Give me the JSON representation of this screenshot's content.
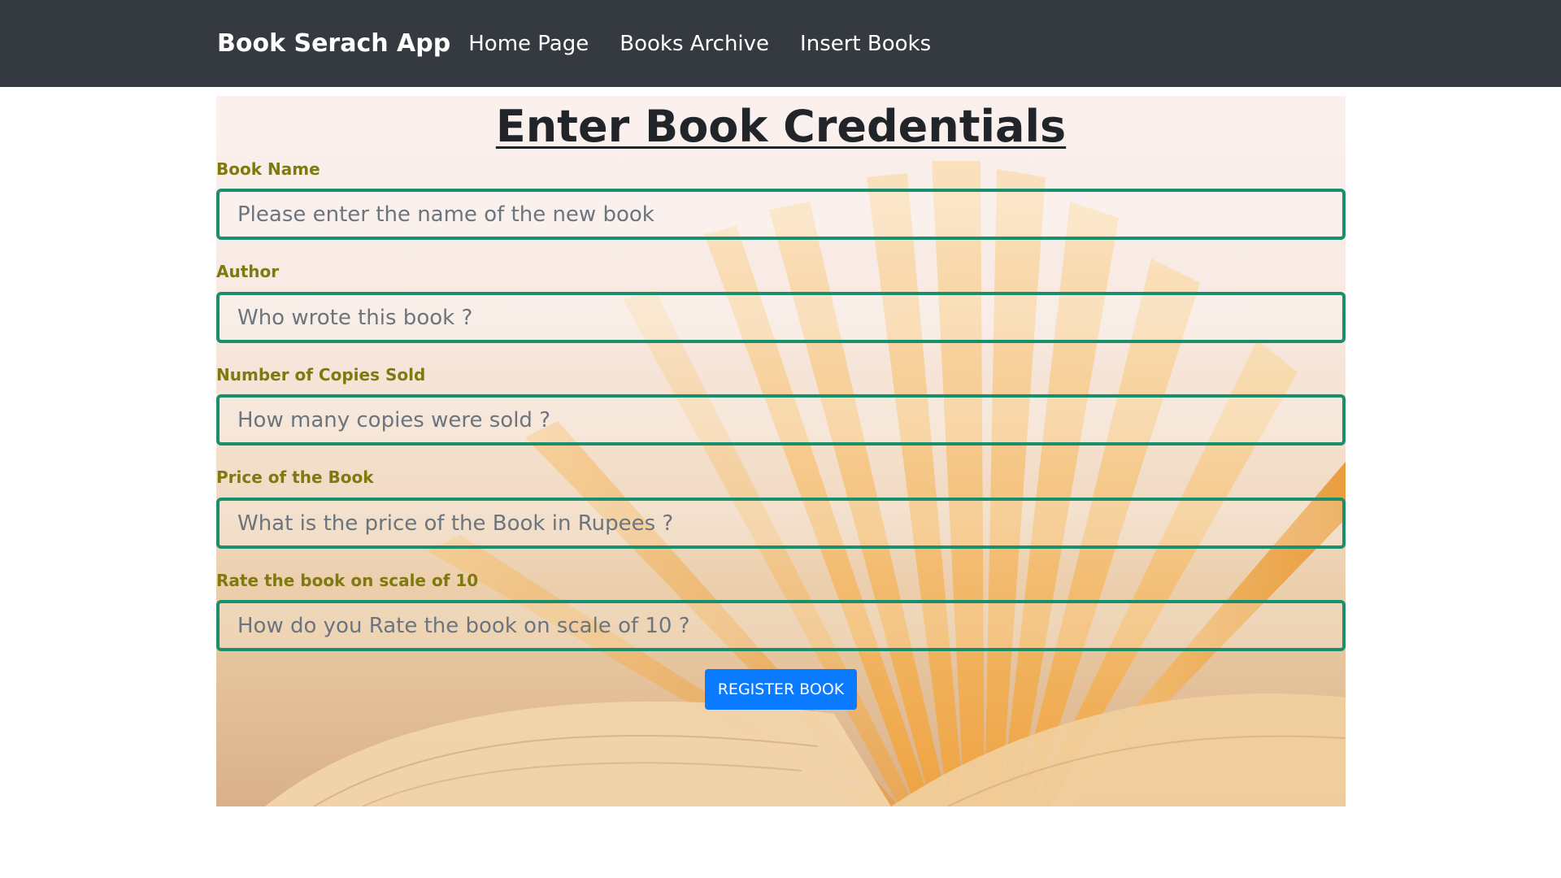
{
  "nav": {
    "brand": "Book Serach App",
    "links": [
      "Home Page",
      "Books Archive",
      "Insert Books"
    ]
  },
  "form": {
    "title": "Enter Book Credentials",
    "fields": [
      {
        "label": "Book Name",
        "placeholder": "Please enter the name of the new book",
        "value": ""
      },
      {
        "label": "Author",
        "placeholder": "Who wrote this book ?",
        "value": ""
      },
      {
        "label": "Number of Copies Sold",
        "placeholder": "How many copies were sold ?",
        "value": ""
      },
      {
        "label": "Price of the Book",
        "placeholder": "What is the price of the Book in Rupees ?",
        "value": ""
      },
      {
        "label": "Rate the book on scale of 10",
        "placeholder": "How do you Rate the book on scale of 10 ?",
        "value": ""
      }
    ],
    "submit_label": "REGISTER BOOK"
  },
  "colors": {
    "navbar_bg": "#343a40",
    "label_color": "#7f7a10",
    "field_border": "#1a8f6e",
    "button_bg": "#0a7bff"
  }
}
